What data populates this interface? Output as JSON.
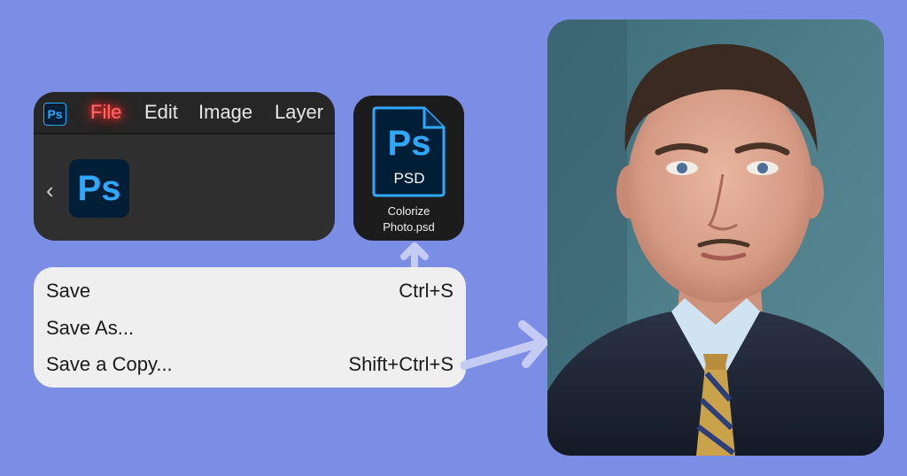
{
  "menubar": {
    "app_icon": "Ps",
    "items": [
      "File",
      "Edit",
      "Image",
      "Layer"
    ]
  },
  "panel": {
    "app_logo": "Ps"
  },
  "file_tile": {
    "icon_text": "Ps",
    "type_label": "PSD",
    "filename_line1": "Colorize",
    "filename_line2": "Photo.psd"
  },
  "save_menu": {
    "items": [
      {
        "label": "Save",
        "shortcut": "Ctrl+S"
      },
      {
        "label": "Save As...",
        "shortcut": ""
      },
      {
        "label": "Save a Copy...",
        "shortcut": "Shift+Ctrl+S"
      }
    ]
  },
  "icons": [
    "photoshop-icon",
    "chevron-left-icon",
    "psd-file-icon",
    "arrow-up-icon",
    "arrow-right-icon"
  ],
  "colors": {
    "background": "#7c8de6",
    "ps_blue": "#31a8ff",
    "ps_dark": "#001e36",
    "file_highlight": "#ff2a2a"
  }
}
